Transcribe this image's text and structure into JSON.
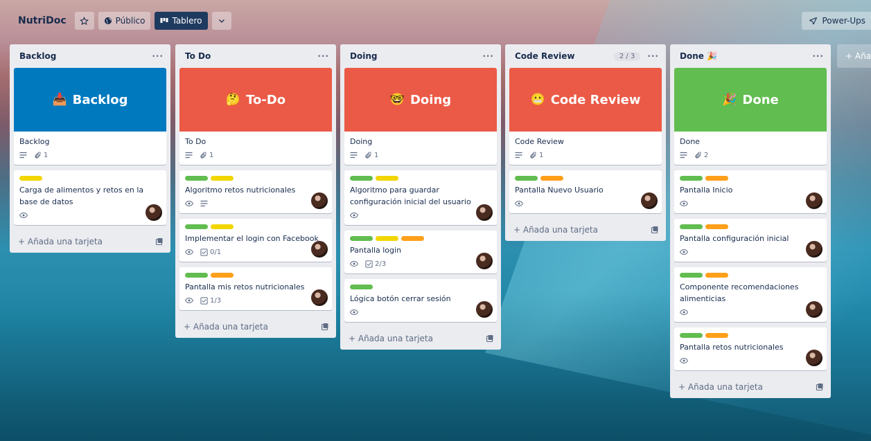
{
  "header": {
    "board_title": "NutriDoc",
    "star_icon": "star-icon",
    "visibility_label": "Público",
    "view_label": "Tablero",
    "powerups_label": "Power-Ups"
  },
  "add_list_label": "+ Aña",
  "add_card_label": "+ Añada una tarjeta",
  "colors": {
    "label_green": "#61bd4f",
    "label_yellow": "#f2d600",
    "label_orange": "#ff9f1a",
    "cover_blue": "#0079bf",
    "cover_red": "#eb5a46",
    "cover_green": "#61bd4f"
  },
  "lists": [
    {
      "title": "Backlog",
      "cover": {
        "emoji": "📥",
        "text": "Backlog",
        "color": "#0079bf"
      },
      "cover_card": {
        "title": "Backlog",
        "attachments": "1"
      },
      "cards": [
        {
          "labels": [
            "yellow"
          ],
          "title": "Carga de alimentos y retos en la base de datos",
          "watch": true,
          "desc": false,
          "checklist": "",
          "avatar": true
        }
      ]
    },
    {
      "title": "To Do",
      "cover": {
        "emoji": "🤔",
        "text": "To-Do",
        "color": "#eb5a46"
      },
      "cover_card": {
        "title": "To Do",
        "attachments": "1"
      },
      "cards": [
        {
          "labels": [
            "green",
            "yellow"
          ],
          "title": "Algoritmo retos nutricionales",
          "watch": true,
          "desc": true,
          "checklist": "",
          "avatar": true
        },
        {
          "labels": [
            "green",
            "yellow"
          ],
          "title": "Implementar el login con Facebook",
          "watch": true,
          "desc": false,
          "checklist": "0/1",
          "avatar": true
        },
        {
          "labels": [
            "green",
            "orange"
          ],
          "title": "Pantalla mis retos nutricionales",
          "watch": true,
          "desc": false,
          "checklist": "1/3",
          "avatar": true
        }
      ]
    },
    {
      "title": "Doing",
      "cover": {
        "emoji": "🤓",
        "text": "Doing",
        "color": "#eb5a46"
      },
      "cover_card": {
        "title": "Doing",
        "attachments": "1"
      },
      "cards": [
        {
          "labels": [
            "green",
            "yellow"
          ],
          "title": "Algoritmo para guardar configuración inicial del usuario",
          "watch": true,
          "desc": false,
          "checklist": "",
          "avatar": true
        },
        {
          "labels": [
            "green",
            "yellow",
            "orange"
          ],
          "title": "Pantalla login",
          "watch": true,
          "desc": false,
          "checklist": "2/3",
          "avatar": true
        },
        {
          "labels": [
            "green"
          ],
          "title": "Lógica botón cerrar sesión",
          "watch": true,
          "desc": false,
          "checklist": "",
          "avatar": true
        }
      ]
    },
    {
      "title": "Code Review",
      "count": "2 / 3",
      "cover": {
        "emoji": "😬",
        "text": "Code Review",
        "color": "#eb5a46"
      },
      "cover_card": {
        "title": "Code Review",
        "attachments": "1"
      },
      "cards": [
        {
          "labels": [
            "green",
            "orange"
          ],
          "title": "Pantalla Nuevo Usuario",
          "watch": true,
          "desc": false,
          "checklist": "",
          "avatar": true
        }
      ]
    },
    {
      "title": "Done 🎉",
      "cover": {
        "emoji": "🎉",
        "text": "Done",
        "color": "#61bd4f"
      },
      "cover_card": {
        "title": "Done",
        "attachments": "2"
      },
      "cards": [
        {
          "labels": [
            "green",
            "orange"
          ],
          "title": "Pantalla Inicio",
          "watch": true,
          "desc": false,
          "checklist": "",
          "avatar": true
        },
        {
          "labels": [
            "green",
            "orange"
          ],
          "title": "Pantalla configuración inicial",
          "watch": true,
          "desc": false,
          "checklist": "",
          "avatar": true
        },
        {
          "labels": [
            "green",
            "orange"
          ],
          "title": "Componente recomendaciones alimenticias",
          "watch": true,
          "desc": false,
          "checklist": "",
          "avatar": true
        },
        {
          "labels": [
            "green",
            "orange"
          ],
          "title": "Pantalla retos nutricionales",
          "watch": true,
          "desc": false,
          "checklist": "",
          "avatar": true
        }
      ]
    }
  ]
}
